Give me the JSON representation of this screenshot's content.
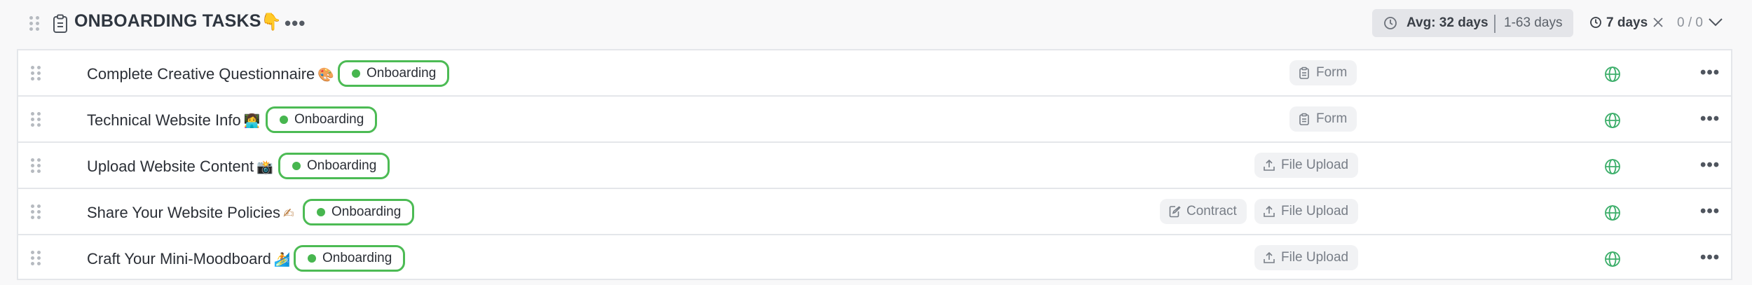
{
  "section": {
    "title": "ONBOARDING TASKS",
    "title_emoji": "👇",
    "more_label": "•••",
    "avg_label": "Avg: 32 days",
    "range_label": "1-63 days",
    "due_label": "7 days",
    "count_label": "0 / 0"
  },
  "colors": {
    "status_green": "#4cbb54",
    "chip_bg": "#f1f2f4",
    "globe_green": "#3cae6a"
  },
  "tasks": [
    {
      "name": "Complete Creative Questionnaire",
      "emoji": "🎨",
      "status": "Onboarding",
      "chips": [
        {
          "icon": "clipboard-icon",
          "label": "Form"
        }
      ]
    },
    {
      "name": "Technical Website Info",
      "emoji": "👩‍💻",
      "status": "Onboarding",
      "chips": [
        {
          "icon": "clipboard-icon",
          "label": "Form"
        }
      ]
    },
    {
      "name": "Upload Website Content",
      "emoji": "📸",
      "status": "Onboarding",
      "chips": [
        {
          "icon": "upload-icon",
          "label": "File Upload"
        }
      ]
    },
    {
      "name": "Share Your Website Policies",
      "emoji": "✍",
      "status": "Onboarding",
      "chips": [
        {
          "icon": "contract-icon",
          "label": "Contract"
        },
        {
          "icon": "upload-icon",
          "label": "File Upload"
        }
      ]
    },
    {
      "name": "Craft Your Mini-Moodboard",
      "emoji": "🏄",
      "status": "Onboarding",
      "chips": [
        {
          "icon": "upload-icon",
          "label": "File Upload"
        }
      ]
    }
  ]
}
